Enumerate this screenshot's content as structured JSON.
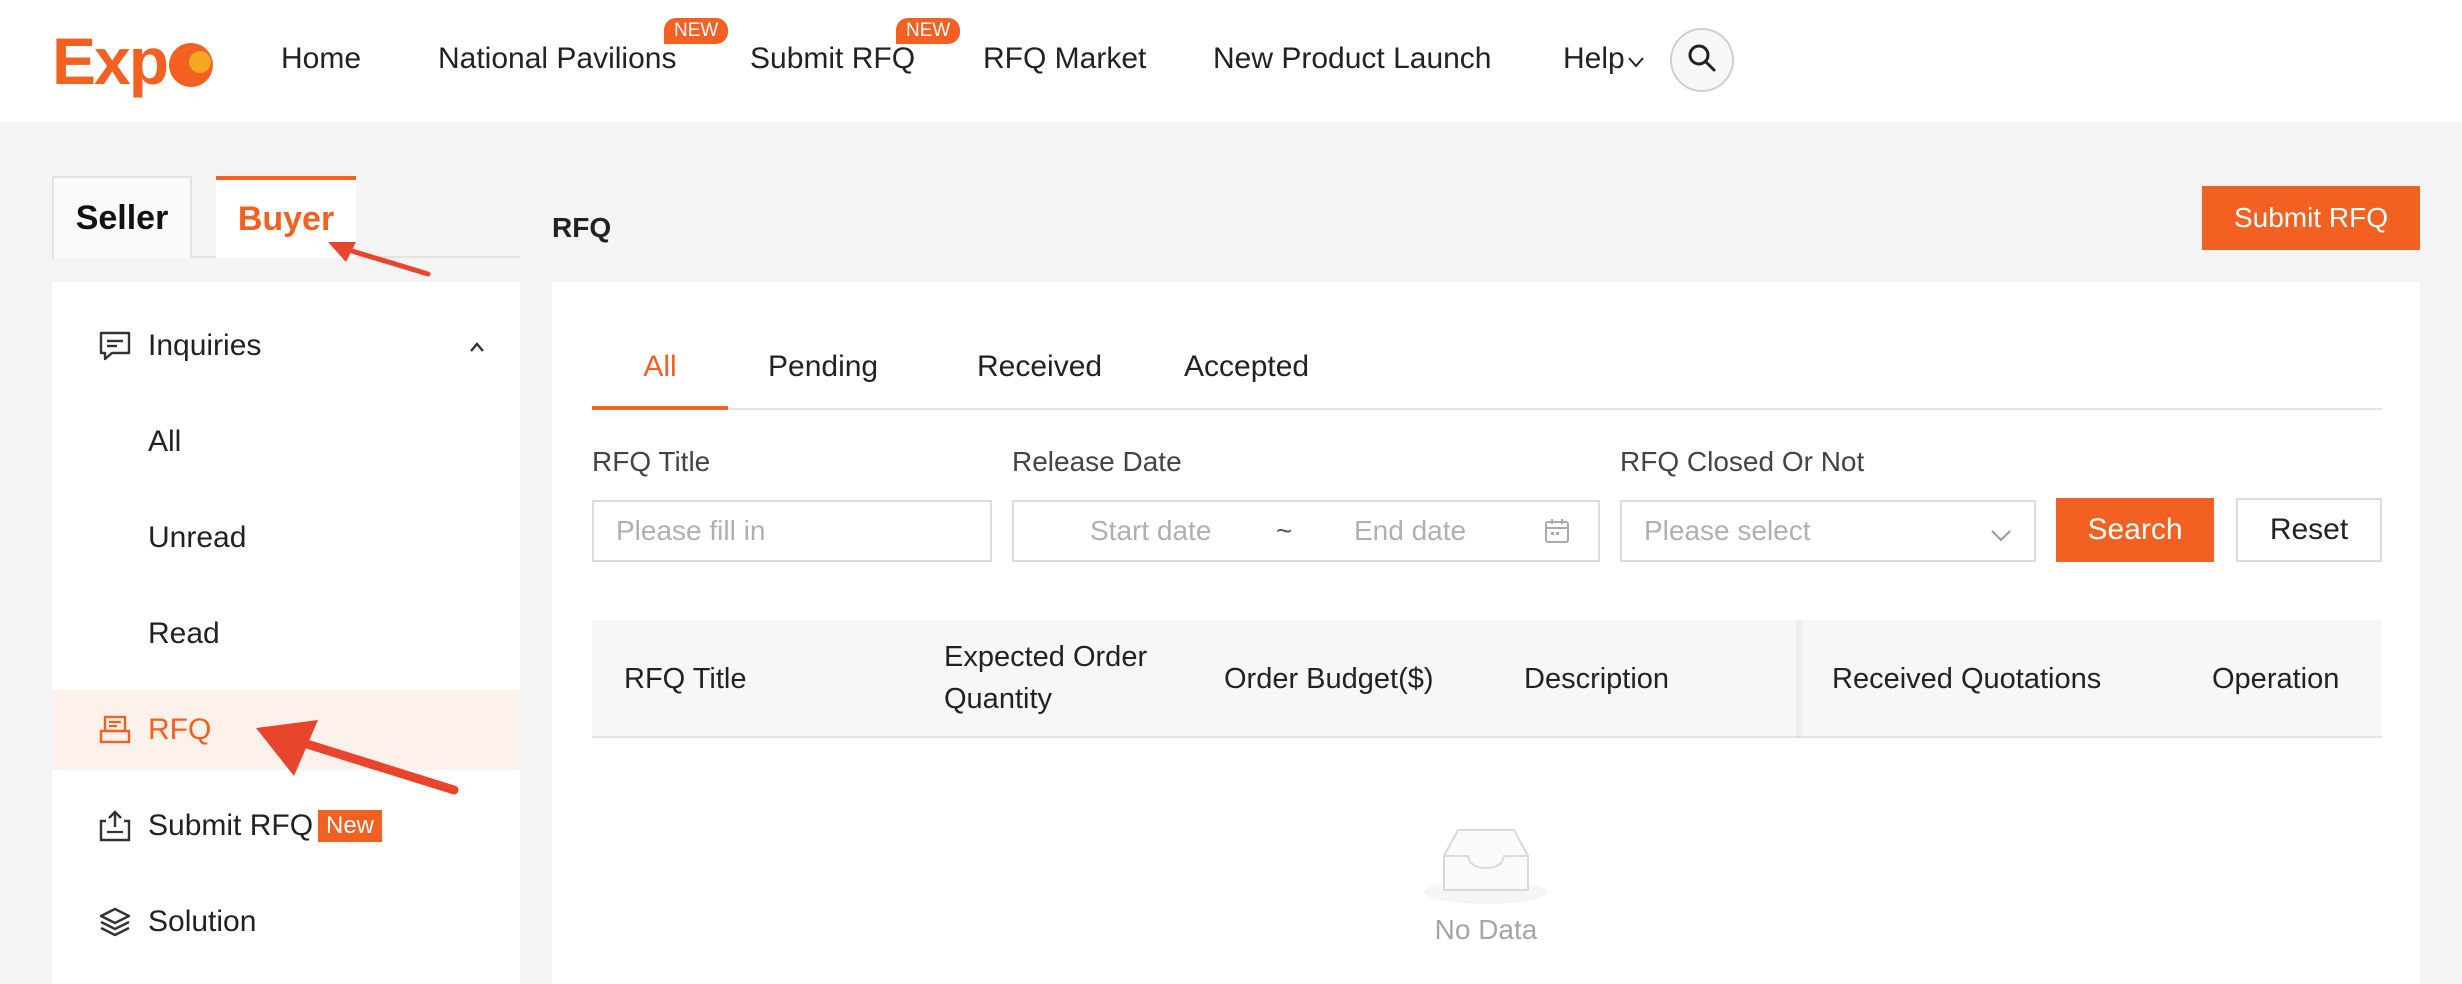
{
  "header": {
    "logo_text": "Exp",
    "nav": [
      {
        "label": "Home"
      },
      {
        "label": "National Pavilions",
        "badge": "NEW"
      },
      {
        "label": "Submit RFQ",
        "badge": "NEW"
      },
      {
        "label": "RFQ Market"
      },
      {
        "label": "New Product Launch"
      },
      {
        "label": "Help"
      }
    ]
  },
  "roles": {
    "seller": "Seller",
    "buyer": "Buyer",
    "active": "Buyer"
  },
  "sidebar": {
    "items": [
      {
        "label": "Inquiries",
        "icon": "message-icon",
        "expanded": true
      },
      {
        "label": "All"
      },
      {
        "label": "Unread"
      },
      {
        "label": "Read"
      },
      {
        "label": "RFQ",
        "icon": "rfq-icon",
        "active": true
      },
      {
        "label": "Submit RFQ",
        "icon": "upload-doc-icon",
        "tag": "New"
      },
      {
        "label": "Solution",
        "icon": "layers-icon"
      }
    ]
  },
  "main": {
    "heading": "RFQ",
    "submit_button": "Submit RFQ",
    "tabs": [
      {
        "label": "All",
        "active": true
      },
      {
        "label": "Pending"
      },
      {
        "label": "Received"
      },
      {
        "label": "Accepted"
      }
    ],
    "filters": {
      "title_label": "RFQ Title",
      "title_placeholder": "Please fill in",
      "date_label": "Release Date",
      "start_placeholder": "Start date",
      "separator": "~",
      "end_placeholder": "End date",
      "closed_label": "RFQ Closed Or Not",
      "closed_placeholder": "Please select",
      "search_button": "Search",
      "reset_button": "Reset"
    },
    "table": {
      "columns": [
        "RFQ Title",
        "Expected Order Quantity",
        "Order Budget($)",
        "Description",
        "Received Quotations",
        "Operation"
      ]
    },
    "empty_text": "No Data"
  },
  "colors": {
    "accent": "#f26122",
    "active_bg": "#fdf1eb"
  }
}
